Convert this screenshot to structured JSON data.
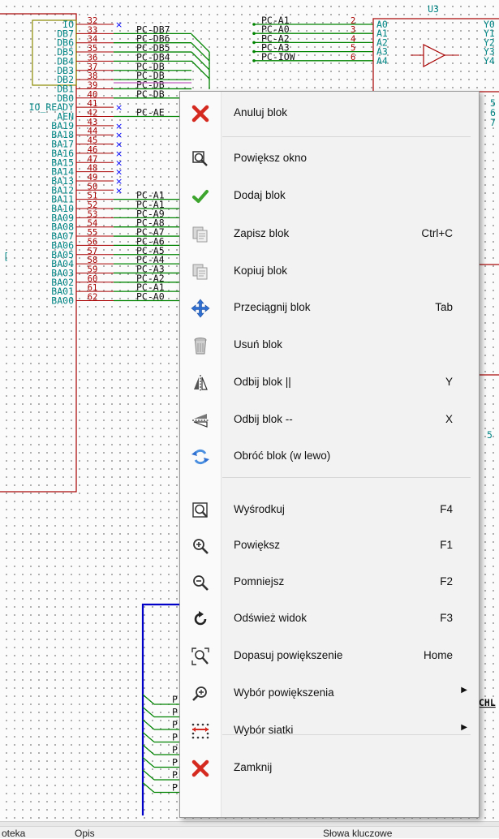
{
  "schematic": {
    "left_pins": [
      {
        "name": "IO",
        "num": "32",
        "net": "",
        "nc": true
      },
      {
        "name": "DB7",
        "num": "33",
        "net": "PC-DB7",
        "nc": false
      },
      {
        "name": "DB6",
        "num": "34",
        "net": "PC-DB6",
        "nc": false
      },
      {
        "name": "DB5",
        "num": "35",
        "net": "PC-DB5",
        "nc": false
      },
      {
        "name": "DB4",
        "num": "36",
        "net": "PC-DB4",
        "nc": false
      },
      {
        "name": "DB3",
        "num": "37",
        "net": "PC-DB",
        "nc": false
      },
      {
        "name": "DB2",
        "num": "38",
        "net": "PC-DB",
        "nc": false
      },
      {
        "name": "DB1",
        "num": "39",
        "net": "PC-DB",
        "nc": false
      },
      {
        "name": "DB0",
        "num": "40",
        "net": "PC-DB",
        "nc": false
      },
      {
        "name": "IO_READY",
        "num": "41",
        "net": "",
        "nc": true
      },
      {
        "name": "AEN",
        "num": "42",
        "net": "PC-AE",
        "nc": false
      },
      {
        "name": "BA19",
        "num": "43",
        "net": "",
        "nc": true
      },
      {
        "name": "BA18",
        "num": "44",
        "net": "",
        "nc": true
      },
      {
        "name": "BA17",
        "num": "45",
        "net": "",
        "nc": true
      },
      {
        "name": "BA16",
        "num": "46",
        "net": "",
        "nc": true
      },
      {
        "name": "BA15",
        "num": "47",
        "net": "",
        "nc": true
      },
      {
        "name": "BA14",
        "num": "48",
        "net": "",
        "nc": true
      },
      {
        "name": "BA13",
        "num": "49",
        "net": "",
        "nc": true
      },
      {
        "name": "BA12",
        "num": "50",
        "net": "",
        "nc": true
      },
      {
        "name": "BA11",
        "num": "51",
        "net": "PC-A1",
        "nc": false
      },
      {
        "name": "BA10",
        "num": "52",
        "net": "PC-A1",
        "nc": false
      },
      {
        "name": "BA09",
        "num": "53",
        "net": "PC-A9",
        "nc": false
      },
      {
        "name": "BA08",
        "num": "54",
        "net": "PC-A8",
        "nc": false
      },
      {
        "name": "BA07",
        "num": "55",
        "net": "PC-A7",
        "nc": false
      },
      {
        "name": "BA06",
        "num": "56",
        "net": "PC-A6",
        "nc": false
      },
      {
        "name": "BA05",
        "num": "57",
        "net": "PC-A5",
        "nc": false
      },
      {
        "name": "BA04",
        "num": "58",
        "net": "PC-A4",
        "nc": false
      },
      {
        "name": "BA03",
        "num": "59",
        "net": "PC-A3",
        "nc": false
      },
      {
        "name": "BA02",
        "num": "60",
        "net": "PC-A2",
        "nc": false
      },
      {
        "name": "BA01",
        "num": "61",
        "net": "PC-A1",
        "nc": false
      },
      {
        "name": "BA00",
        "num": "62",
        "net": "PC-A0",
        "nc": false
      }
    ],
    "top_nets": [
      {
        "net": "PC-A1",
        "num": "2",
        "pin": "A0",
        "out": "Y0"
      },
      {
        "net": "PC-A0",
        "num": "3",
        "pin": "A1",
        "out": "Y1"
      },
      {
        "net": "PC-A2",
        "num": "4",
        "pin": "A2",
        "out": "Y2"
      },
      {
        "net": "PC-A3",
        "num": "5",
        "pin": "A3",
        "out": "Y3"
      },
      {
        "net": "PC-IOW",
        "num": "6",
        "pin": "A4",
        "out": "Y4"
      }
    ],
    "u3_label": "U3",
    "right_edge_texts": [
      "5",
      "6",
      "7"
    ],
    "right_edge_number": "5",
    "bus_letter": "P",
    "bus_label": "CHL",
    "left_fragment": "["
  },
  "context_menu": {
    "items": [
      {
        "label": "Anuluj blok",
        "shortcut": "",
        "icon": "cancel-x-icon",
        "submenu": false
      },
      {
        "label": "Powiększ okno",
        "shortcut": "",
        "icon": "zoom-window-icon",
        "submenu": false
      },
      {
        "label": "Dodaj blok",
        "shortcut": "",
        "icon": "checkmark-icon",
        "submenu": false
      },
      {
        "label": "Zapisz blok",
        "shortcut": "Ctrl+C",
        "icon": "save-block-icon",
        "submenu": false
      },
      {
        "label": "Kopiuj blok",
        "shortcut": "",
        "icon": "copy-block-icon",
        "submenu": false
      },
      {
        "label": "Przeciągnij blok",
        "shortcut": "Tab",
        "icon": "move-arrows-icon",
        "submenu": false
      },
      {
        "label": "Usuń blok",
        "shortcut": "",
        "icon": "trash-can-icon",
        "submenu": false
      },
      {
        "label": "Odbij blok ||",
        "shortcut": "Y",
        "icon": "mirror-vertical-icon",
        "submenu": false
      },
      {
        "label": "Odbij blok --",
        "shortcut": "X",
        "icon": "mirror-horizontal-icon",
        "submenu": false
      },
      {
        "label": "Obróć blok (w lewo)",
        "shortcut": "",
        "icon": "rotate-ccw-icon",
        "submenu": false
      },
      {
        "label": "Wyśrodkuj",
        "shortcut": "F4",
        "icon": "center-view-icon",
        "submenu": false
      },
      {
        "label": "Powiększ",
        "shortcut": "F1",
        "icon": "zoom-in-icon",
        "submenu": false
      },
      {
        "label": "Pomniejsz",
        "shortcut": "F2",
        "icon": "zoom-out-icon",
        "submenu": false
      },
      {
        "label": "Odśwież widok",
        "shortcut": "F3",
        "icon": "refresh-icon",
        "submenu": false
      },
      {
        "label": "Dopasuj powiększenie",
        "shortcut": "Home",
        "icon": "zoom-fit-icon",
        "submenu": false
      },
      {
        "label": "Wybór powiększenia",
        "shortcut": "",
        "icon": "zoom-select-icon",
        "submenu": true
      },
      {
        "label": "Wybór siatki",
        "shortcut": "",
        "icon": "grid-icon",
        "submenu": true
      },
      {
        "label": "Zamknij",
        "shortcut": "",
        "icon": "close-x-icon",
        "submenu": false
      }
    ]
  },
  "statusbar": {
    "col1": "oteka",
    "col2": "Opis",
    "col3": "Słowa kluczowe"
  },
  "colors": {
    "wire": "#008400",
    "component": "#a80000",
    "pin_text": "#008484",
    "bus": "#0000c8",
    "nc_marker": "#0000ff",
    "menu_bg": "#f2f2f2",
    "cancel_red": "#d42a1f"
  }
}
